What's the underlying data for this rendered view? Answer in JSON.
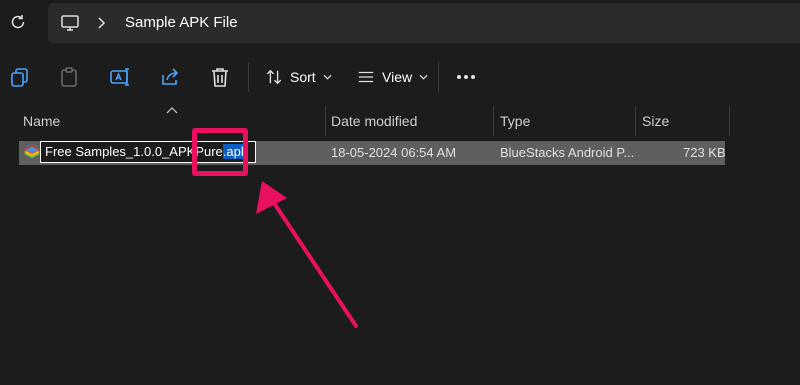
{
  "breadcrumb": {
    "folder": "Sample APK File"
  },
  "toolbar": {
    "sort_label": "Sort",
    "view_label": "View"
  },
  "columns": {
    "name": "Name",
    "date": "Date modified",
    "type": "Type",
    "size": "Size"
  },
  "file": {
    "name_base": "Free Samples_1.0.0_APKPure",
    "name_selected": ".apk",
    "date": "18-05-2024 06:54 AM",
    "type": "BlueStacks Android P...",
    "size": "723 KB"
  },
  "colors": {
    "annotation": "#e8105f",
    "selection": "#0a5ec2",
    "accent": "#4aa3ff"
  },
  "icons": [
    "refresh-icon",
    "this-pc-icon",
    "chevron-right-icon",
    "copy-icon",
    "paste-icon",
    "rename-icon",
    "share-icon",
    "delete-icon",
    "sort-icon",
    "view-icon",
    "more-icon",
    "bluestacks-icon"
  ]
}
